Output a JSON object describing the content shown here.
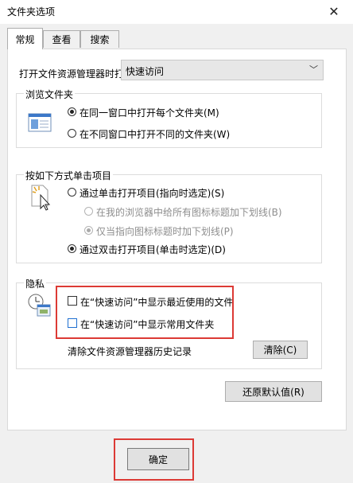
{
  "window": {
    "title": "文件夹选项"
  },
  "tabs": [
    {
      "label": "常规"
    },
    {
      "label": "查看"
    },
    {
      "label": "搜索"
    }
  ],
  "open_in": {
    "label": "打开文件资源管理器时打",
    "value": "快速访问"
  },
  "browse": {
    "title": "浏览文件夹",
    "options": [
      "在同一窗口中打开每个文件夹(M)",
      "在不同窗口中打开不同的文件夹(W)"
    ]
  },
  "click": {
    "title": "按如下方式单击项目",
    "options": [
      "通过单击打开项目(指向时选定)(S)",
      "在我的浏览器中给所有图标标题加下划线(B)",
      "仅当指向图标标题时加下划线(P)",
      "通过双击打开项目(单击时选定)(D)"
    ]
  },
  "privacy": {
    "title": "隐私",
    "checks": [
      "在“快速访问”中显示最近使用的文件",
      "在“快速访问”中显示常用文件夹"
    ],
    "clear_label": "清除文件资源管理器历史记录",
    "clear_button": "清除(C)"
  },
  "restore_button": "还原默认值(R)",
  "ok_button": "确定",
  "accent_colors": {
    "highlight_box": "#dc3a35"
  }
}
